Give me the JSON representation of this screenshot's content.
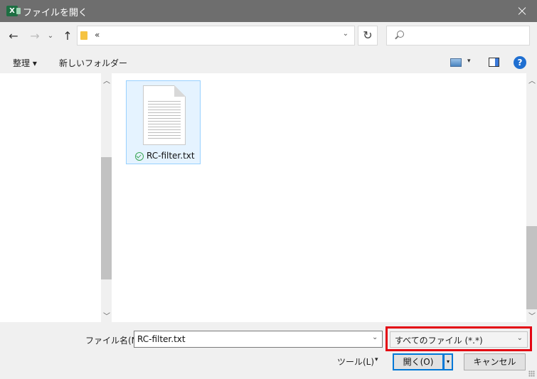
{
  "window": {
    "title": "ファイルを開く",
    "app_icon_letter": "X"
  },
  "nav": {
    "back_glyph": "←",
    "forward_glyph": "→",
    "recent_glyph": "⌄",
    "up_glyph": "↑",
    "address_text": "«",
    "address_dropdown_glyph": "⌄",
    "refresh_glyph": "↻"
  },
  "toolbar": {
    "organize_label": "整理 ▾",
    "new_folder_label": "新しいフォルダー",
    "view_dropdown_glyph": "▾",
    "help_label": "?"
  },
  "scroll": {
    "up_glyph": "︿",
    "down_glyph": "﹀"
  },
  "files": [
    {
      "name": "RC-filter.txt"
    }
  ],
  "bottom": {
    "filename_label": "ファイル名(N):",
    "filename_value": "RC-filter.txt",
    "dropdown_glyph": "⌄",
    "filetype_value": "すべてのファイル (*.*)",
    "tools_label": "ツール(L)",
    "tools_dropdown_glyph": "▾",
    "open_label": "開く(O)",
    "open_split_glyph": "▾",
    "cancel_label": "キャンセル"
  },
  "colors": {
    "titlebar": "#6e6e6e",
    "selection_bg": "#e5f3ff",
    "selection_border": "#99d1ff",
    "accent": "#0078d7",
    "highlight": "#e30613",
    "excel_green": "#1d6f42"
  }
}
